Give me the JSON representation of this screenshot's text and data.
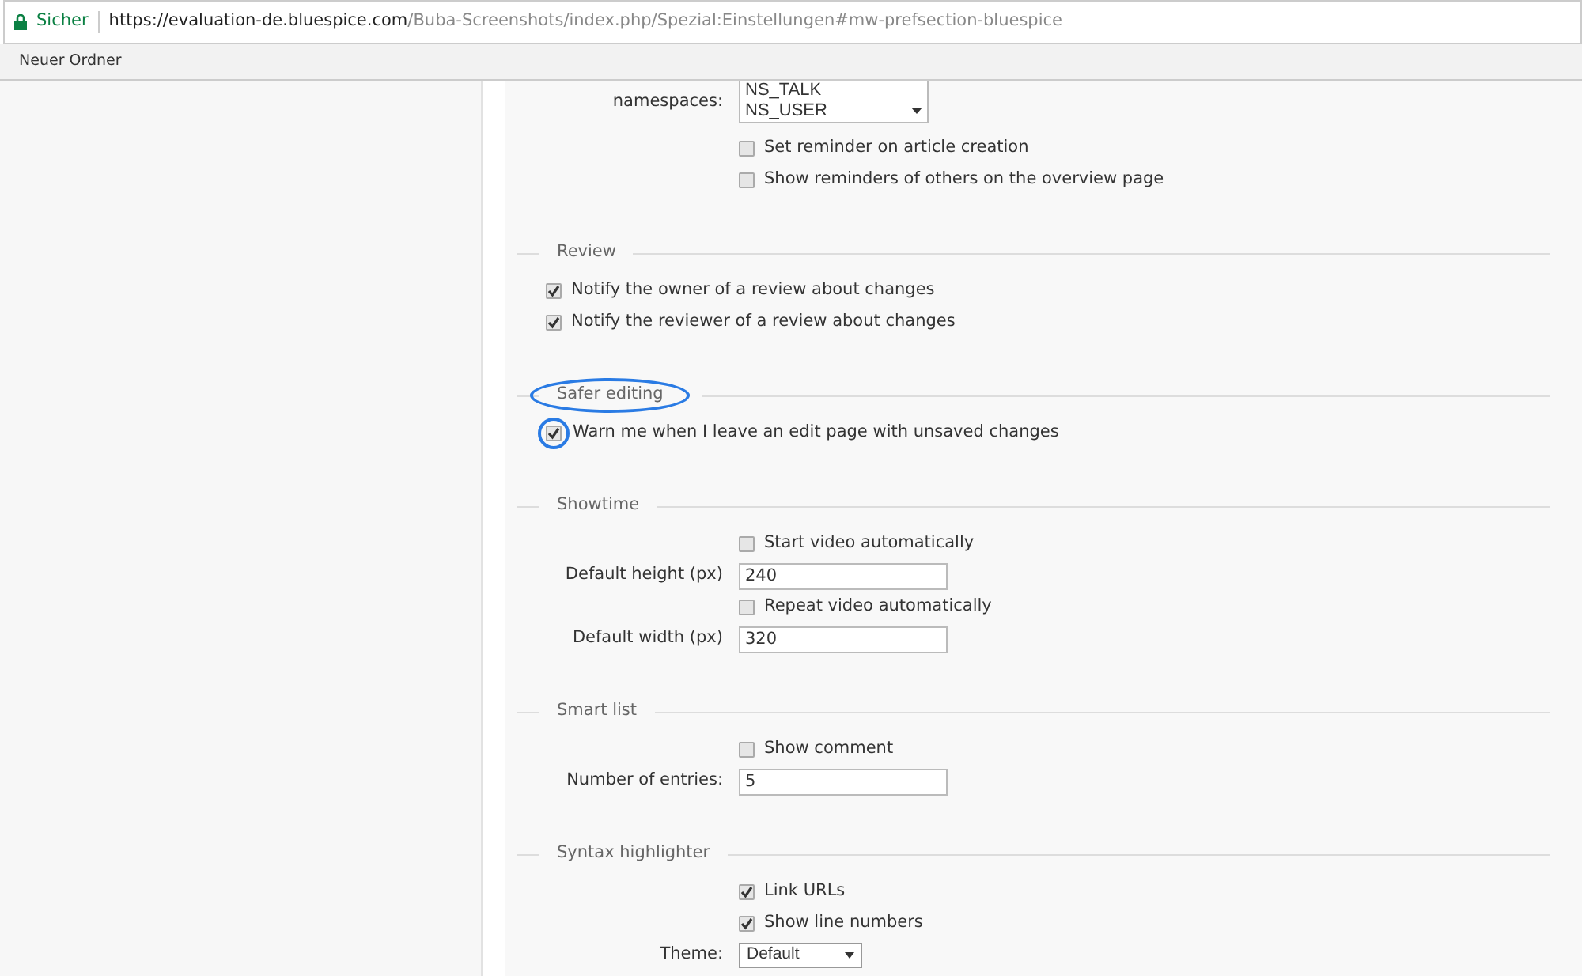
{
  "browser": {
    "secure_label": "Sicher",
    "url_host": "https://evaluation-de.bluespice.com",
    "url_path": "/Buba-Screenshots/index.php/Spezial:Einstellungen#mw-prefsection-bluespice",
    "bookmarks": [
      "Neuer Ordner"
    ]
  },
  "sections": [
    {
      "rows": [
        {
          "kind": "listbox",
          "label": "namespaces:",
          "options": [
            "NS_TALK",
            "NS_USER"
          ]
        },
        {
          "kind": "checkbox",
          "text": "Set reminder on article creation",
          "checked": false
        },
        {
          "kind": "checkbox",
          "text": "Show reminders of others on the overview page",
          "checked": false
        }
      ]
    },
    {
      "legend": "Review",
      "rows": [
        {
          "kind": "flush_checkbox",
          "text": "Notify the owner of a review about changes",
          "checked": true
        },
        {
          "kind": "flush_checkbox",
          "text": "Notify the reviewer of a review about changes",
          "checked": true
        }
      ]
    },
    {
      "legend": "Safer editing",
      "highlighted": true,
      "rows": [
        {
          "kind": "flush_checkbox",
          "text": "Warn me when I leave an edit page with unsaved changes",
          "checked": true,
          "highlighted": true
        }
      ]
    },
    {
      "legend": "Showtime",
      "rows": [
        {
          "kind": "checkbox",
          "text": "Start video automatically",
          "checked": false
        },
        {
          "kind": "text",
          "label": "Default height (px)",
          "value": "240"
        },
        {
          "kind": "checkbox",
          "text": "Repeat video automatically",
          "checked": false
        },
        {
          "kind": "text",
          "label": "Default width (px)",
          "value": "320"
        }
      ]
    },
    {
      "legend": "Smart list",
      "rows": [
        {
          "kind": "checkbox",
          "text": "Show comment",
          "checked": false
        },
        {
          "kind": "text",
          "label": "Number of entries:",
          "value": "5"
        }
      ]
    },
    {
      "legend": "Syntax highlighter",
      "rows": [
        {
          "kind": "checkbox",
          "text": "Link URLs",
          "checked": true
        },
        {
          "kind": "checkbox",
          "text": "Show line numbers",
          "checked": true
        },
        {
          "kind": "select",
          "label": "Theme:",
          "value": "Default"
        }
      ]
    }
  ]
}
